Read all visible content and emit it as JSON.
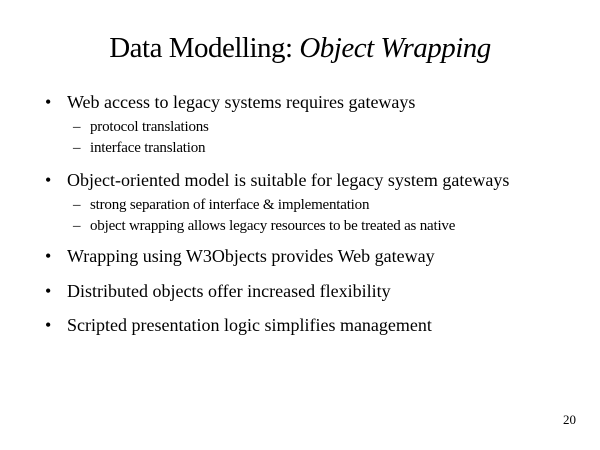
{
  "slide": {
    "title_plain": "Data Modelling: ",
    "title_italic": "Object Wrapping",
    "bullets": [
      {
        "text": "Web access to legacy systems requires gateways",
        "subs": [
          "protocol translations",
          "interface translation"
        ]
      },
      {
        "text": "Object-oriented model is suitable for legacy system gateways",
        "subs": [
          "strong separation of interface & implementation",
          "object wrapping allows legacy resources to be treated as native"
        ]
      },
      {
        "text": "Wrapping using W3Objects provides Web gateway",
        "subs": []
      },
      {
        "text": "Distributed objects offer increased flexibility",
        "subs": []
      },
      {
        "text": "Scripted presentation logic simplifies management",
        "subs": []
      }
    ],
    "bullet_glyph": "•",
    "sub_glyph": "–",
    "page_number": "20"
  }
}
